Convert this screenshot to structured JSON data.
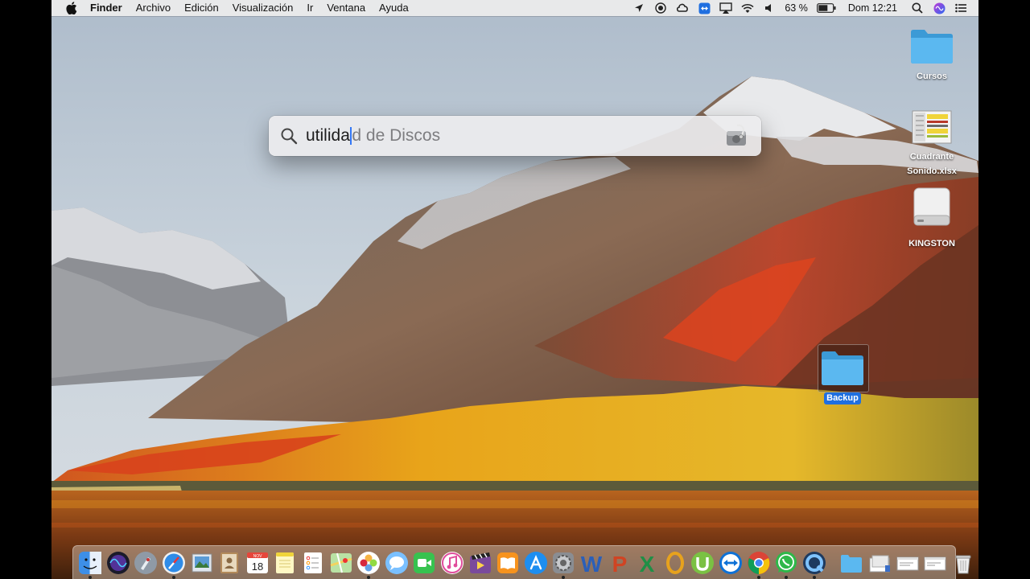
{
  "menubar": {
    "app_name": "Finder",
    "menus": [
      "Archivo",
      "Edición",
      "Visualización",
      "Ir",
      "Ventana",
      "Ayuda"
    ],
    "battery_percent": "63 %",
    "clock": "Dom 12:21"
  },
  "spotlight": {
    "typed": "utilida",
    "suggestion": "d de Discos"
  },
  "desktop": {
    "items": [
      {
        "label": "Cursos",
        "icon": "folder-icon"
      },
      {
        "label": "Cuadrante Sonido.xlsx",
        "icon": "spreadsheet-file-icon"
      },
      {
        "label": "KINGSTON",
        "icon": "external-drive-icon"
      },
      {
        "label": "Backup",
        "icon": "folder-icon",
        "selected": true
      }
    ]
  },
  "dock": {
    "apps": [
      "finder-icon",
      "siri-icon",
      "launchpad-icon",
      "safari-icon",
      "preview-icon",
      "contacts-icon",
      "calendar-icon",
      "notes-icon",
      "reminders-icon",
      "maps-icon",
      "photos-icon",
      "messages-icon",
      "facetime-icon",
      "itunes-icon",
      "imovie-icon",
      "ibooks-icon",
      "app-store-icon",
      "system-preferences-icon",
      "word-icon",
      "powerpoint-icon",
      "excel-icon",
      "lightroom-icon",
      "utorrent-icon",
      "teamviewer-icon",
      "chrome-icon",
      "whatsapp-icon",
      "quicktime-icon"
    ],
    "calendar_day": "18",
    "calendar_month": "NOV"
  },
  "colors": {
    "accent": "#1f6fe0",
    "menubar_bg": "#ececec",
    "folder_blue": "#5bb8f0"
  }
}
